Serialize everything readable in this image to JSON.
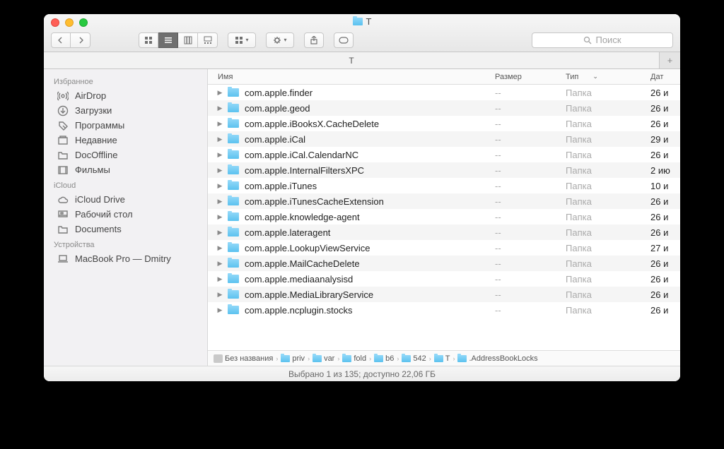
{
  "window": {
    "title": "T"
  },
  "search": {
    "placeholder": "Поиск"
  },
  "tab": {
    "label": "T"
  },
  "columns": {
    "name": "Имя",
    "size": "Размер",
    "type": "Тип",
    "date": "Дат"
  },
  "sidebar": {
    "sections": [
      {
        "header": "Избранное",
        "items": [
          {
            "icon": "airdrop",
            "label": "AirDrop"
          },
          {
            "icon": "downloads",
            "label": "Загрузки"
          },
          {
            "icon": "applications",
            "label": "Программы"
          },
          {
            "icon": "recents",
            "label": "Недавние"
          },
          {
            "icon": "folder",
            "label": "DocOffline"
          },
          {
            "icon": "movies",
            "label": "Фильмы"
          }
        ]
      },
      {
        "header": "iCloud",
        "items": [
          {
            "icon": "icloud",
            "label": "iCloud Drive"
          },
          {
            "icon": "desktop",
            "label": "Рабочий стол"
          },
          {
            "icon": "folder",
            "label": "Documents"
          }
        ]
      },
      {
        "header": "Устройства",
        "items": [
          {
            "icon": "laptop",
            "label": "MacBook Pro — Dmitry"
          }
        ]
      }
    ]
  },
  "files": [
    {
      "name": "com.apple.finder",
      "size": "--",
      "type": "Папка",
      "date": "26 и"
    },
    {
      "name": "com.apple.geod",
      "size": "--",
      "type": "Папка",
      "date": "26 и"
    },
    {
      "name": "com.apple.iBooksX.CacheDelete",
      "size": "--",
      "type": "Папка",
      "date": "26 и"
    },
    {
      "name": "com.apple.iCal",
      "size": "--",
      "type": "Папка",
      "date": "29 и"
    },
    {
      "name": "com.apple.iCal.CalendarNC",
      "size": "--",
      "type": "Папка",
      "date": "26 и"
    },
    {
      "name": "com.apple.InternalFiltersXPC",
      "size": "--",
      "type": "Папка",
      "date": "2 ию"
    },
    {
      "name": "com.apple.iTunes",
      "size": "--",
      "type": "Папка",
      "date": "10 и"
    },
    {
      "name": "com.apple.iTunesCacheExtension",
      "size": "--",
      "type": "Папка",
      "date": "26 и"
    },
    {
      "name": "com.apple.knowledge-agent",
      "size": "--",
      "type": "Папка",
      "date": "26 и"
    },
    {
      "name": "com.apple.lateragent",
      "size": "--",
      "type": "Папка",
      "date": "26 и"
    },
    {
      "name": "com.apple.LookupViewService",
      "size": "--",
      "type": "Папка",
      "date": "27 и"
    },
    {
      "name": "com.apple.MailCacheDelete",
      "size": "--",
      "type": "Папка",
      "date": "26 и"
    },
    {
      "name": "com.apple.mediaanalysisd",
      "size": "--",
      "type": "Папка",
      "date": "26 и"
    },
    {
      "name": "com.apple.MediaLibraryService",
      "size": "--",
      "type": "Папка",
      "date": "26 и"
    },
    {
      "name": "com.apple.ncplugin.stocks",
      "size": "--",
      "type": "Папка",
      "date": "26 и"
    }
  ],
  "path": [
    {
      "type": "disk",
      "label": "Без названия"
    },
    {
      "type": "folder",
      "label": "priv"
    },
    {
      "type": "folder",
      "label": "var"
    },
    {
      "type": "folder",
      "label": "fold"
    },
    {
      "type": "folder",
      "label": "b6"
    },
    {
      "type": "folder",
      "label": "542"
    },
    {
      "type": "folder",
      "label": "T"
    },
    {
      "type": "folder",
      "label": ".AddressBookLocks"
    }
  ],
  "status": "Выбрано 1 из 135; доступно 22,06 ГБ"
}
